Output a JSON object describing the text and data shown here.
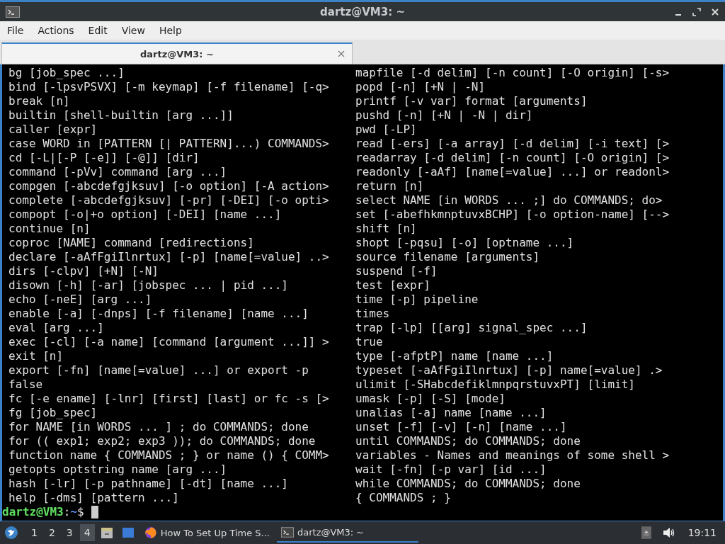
{
  "window": {
    "title": "dartz@VM3: ~"
  },
  "menu": [
    "File",
    "Actions",
    "Edit",
    "View",
    "Help"
  ],
  "tabs": [
    {
      "label": "dartz@VM3: ~",
      "selected": true
    }
  ],
  "terminal": {
    "lines": [
      {
        "left": "bg [job_spec ...]",
        "right": "mapfile [-d delim] [-n count] [-O origin] [-s>"
      },
      {
        "left": "bind [-lpsvPSVX] [-m keymap] [-f filename] [-q>",
        "right": "popd [-n] [+N | -N]"
      },
      {
        "left": "break [n]",
        "right": "printf [-v var] format [arguments]"
      },
      {
        "left": "builtin [shell-builtin [arg ...]]",
        "right": "pushd [-n] [+N | -N | dir]"
      },
      {
        "left": "caller [expr]",
        "right": "pwd [-LP]"
      },
      {
        "left": "case WORD in [PATTERN [| PATTERN]...) COMMANDS>",
        "right": "read [-ers] [-a array] [-d delim] [-i text] [>"
      },
      {
        "left": "cd [-L|[-P [-e]] [-@]] [dir]",
        "right": "readarray [-d delim] [-n count] [-O origin] [>"
      },
      {
        "left": "command [-pVv] command [arg ...]",
        "right": "readonly [-aAf] [name[=value] ...] or readonl>"
      },
      {
        "left": "compgen [-abcdefgjksuv] [-o option] [-A action>",
        "right": "return [n]"
      },
      {
        "left": "complete [-abcdefgjksuv] [-pr] [-DEI] [-o opti>",
        "right": "select NAME [in WORDS ... ;] do COMMANDS; do>"
      },
      {
        "left": "compopt [-o|+o option] [-DEI] [name ...]",
        "right": "set [-abefhkmnptuvxBCHP] [-o option-name] [-->"
      },
      {
        "left": "continue [n]",
        "right": "shift [n]"
      },
      {
        "left": "coproc [NAME] command [redirections]",
        "right": "shopt [-pqsu] [-o] [optname ...]"
      },
      {
        "left": "declare [-aAfFgiIlnrtux] [-p] [name[=value] ..>",
        "right": "source filename [arguments]"
      },
      {
        "left": "dirs [-clpv] [+N] [-N]",
        "right": "suspend [-f]"
      },
      {
        "left": "disown [-h] [-ar] [jobspec ... | pid ...]",
        "right": "test [expr]"
      },
      {
        "left": "echo [-neE] [arg ...]",
        "right": "time [-p] pipeline"
      },
      {
        "left": "enable [-a] [-dnps] [-f filename] [name ...]",
        "right": "times"
      },
      {
        "left": "eval [arg ...]",
        "right": "trap [-lp] [[arg] signal_spec ...]"
      },
      {
        "left": "exec [-cl] [-a name] [command [argument ...]] >",
        "right": "true"
      },
      {
        "left": "exit [n]",
        "right": "type [-afptP] name [name ...]"
      },
      {
        "left": "export [-fn] [name[=value] ...] or export -p",
        "right": "typeset [-aAfFgiIlnrtux] [-p] name[=value] .>"
      },
      {
        "left": "false",
        "right": "ulimit [-SHabcdefiklmnpqrstuvxPT] [limit]"
      },
      {
        "left": "fc [-e ename] [-lnr] [first] [last] or fc -s [>",
        "right": "umask [-p] [-S] [mode]"
      },
      {
        "left": "fg [job_spec]",
        "right": "unalias [-a] name [name ...]"
      },
      {
        "left": "for NAME [in WORDS ... ] ; do COMMANDS; done",
        "right": "unset [-f] [-v] [-n] [name ...]"
      },
      {
        "left": "for (( exp1; exp2; exp3 )); do COMMANDS; done",
        "right": "until COMMANDS; do COMMANDS; done"
      },
      {
        "left": "function name { COMMANDS ; } or name () { COMM>",
        "right": "variables - Names and meanings of some shell >"
      },
      {
        "left": "getopts optstring name [arg ...]",
        "right": "wait [-fn] [-p var] [id ...]"
      },
      {
        "left": "hash [-lr] [-p pathname] [-dt] [name ...]",
        "right": "while COMMANDS; do COMMANDS; done"
      },
      {
        "left": "help [-dms] [pattern ...]",
        "right": "{ COMMANDS ; }"
      }
    ],
    "prompt": {
      "user_host": "dartz@VM3",
      "separator": ":",
      "path": "~",
      "symbol": "$"
    }
  },
  "taskbar": {
    "workspaces": [
      {
        "label": "1",
        "selected": false
      },
      {
        "label": "2",
        "selected": false
      },
      {
        "label": "3",
        "selected": false
      },
      {
        "label": "4",
        "selected": true
      }
    ],
    "tasks": [
      {
        "kind": "browser",
        "label": "How To Set Up Time S...",
        "selected": false
      },
      {
        "kind": "terminal",
        "label": "dartz@VM3: ~",
        "selected": true
      }
    ],
    "clock": "19:11"
  }
}
